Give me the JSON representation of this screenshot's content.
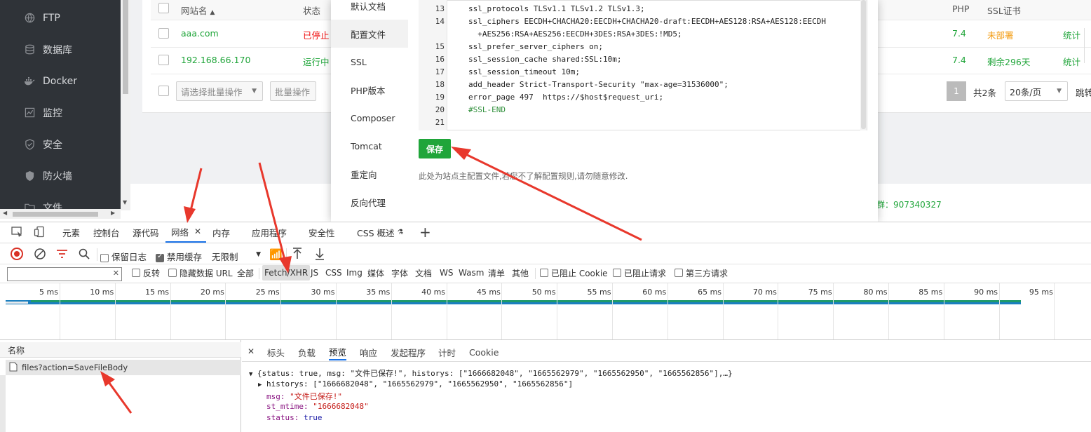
{
  "sidebar": {
    "items": [
      {
        "label": "FTP",
        "icon": "globe-icon"
      },
      {
        "label": "数据库",
        "icon": "database-icon"
      },
      {
        "label": "Docker",
        "icon": "docker-icon"
      },
      {
        "label": "监控",
        "icon": "monitor-icon"
      },
      {
        "label": "安全",
        "icon": "shield-icon"
      },
      {
        "label": "防火墙",
        "icon": "firewall-icon"
      },
      {
        "label": "文件",
        "icon": "folder-icon"
      }
    ]
  },
  "site_table": {
    "headers": {
      "name": "网站名",
      "status": "状态",
      "php": "PHP",
      "ssl": "SSL证书"
    },
    "rows": [
      {
        "name": "aaa.com",
        "status": "已停止",
        "php": "7.4",
        "ssl": "未部署",
        "action": "统计"
      },
      {
        "name": "192.168.66.170",
        "status": "运行中",
        "php": "7.4",
        "ssl": "剩余296天",
        "action": "统计"
      }
    ],
    "batch_select_placeholder": "请选择批量操作",
    "batch_button": "批量操作",
    "pagination": {
      "current_page": "1",
      "total": "共2条",
      "per_page": "20条/页",
      "jump": "跳转"
    },
    "footer_text": "群：907340327"
  },
  "dialog": {
    "menu": [
      {
        "label": "默认文档",
        "active": false
      },
      {
        "label": "配置文件",
        "active": true
      },
      {
        "label": "SSL",
        "active": false
      },
      {
        "label": "PHP版本",
        "active": false
      },
      {
        "label": "Composer",
        "active": false
      },
      {
        "label": "Tomcat",
        "active": false
      },
      {
        "label": "重定向",
        "active": false
      },
      {
        "label": "反向代理",
        "active": false
      }
    ],
    "editor_lines": [
      {
        "num": "13",
        "text": "ssl_protocols TLSv1.1 TLSv1.2 TLSv1.3;"
      },
      {
        "num": "14",
        "text": "ssl_ciphers EECDH+CHACHA20:EECDH+CHACHA20-draft:EECDH+AES128:RSA+AES128:EECDH"
      },
      {
        "num": "",
        "text": "  +AES256:RSA+AES256:EECDH+3DES:RSA+3DES:!MD5;"
      },
      {
        "num": "15",
        "text": "ssl_prefer_server_ciphers on;"
      },
      {
        "num": "16",
        "text": "ssl_session_cache shared:SSL:10m;"
      },
      {
        "num": "17",
        "text": "ssl_session_timeout 10m;"
      },
      {
        "num": "18",
        "text": "add_header Strict-Transport-Security \"max-age=31536000\";"
      },
      {
        "num": "19",
        "text": "error_page 497  https://$host$request_uri;"
      },
      {
        "num": "20",
        "text": "#SSL-END"
      },
      {
        "num": "21",
        "text": ""
      }
    ],
    "save_label": "保存",
    "note": "此处为站点主配置文件,若您不了解配置规则,请勿随意修改."
  },
  "devtools": {
    "tabs": [
      "元素",
      "控制台",
      "源代码",
      "网络",
      "内存",
      "应用程序",
      "安全性",
      "CSS 概述"
    ],
    "active_tab": "网络",
    "toolbar": {
      "preserve_log": "保留日志",
      "disable_cache": "禁用缓存",
      "throttle": "无限制"
    },
    "filters": {
      "invert": "反转",
      "hide_data_url": "隐藏数据 URL",
      "types": [
        "全部",
        "Fetch/XHR",
        "JS",
        "CSS",
        "Img",
        "媒体",
        "字体",
        "文档",
        "WS",
        "Wasm",
        "清单",
        "其他"
      ],
      "active_type": "Fetch/XHR",
      "blocked_cookie": "已阻止 Cookie",
      "blocked_requests": "已阻止请求",
      "third_party": "第三方请求"
    },
    "timeline_ticks": [
      "5 ms",
      "10 ms",
      "15 ms",
      "20 ms",
      "25 ms",
      "30 ms",
      "35 ms",
      "40 ms",
      "45 ms",
      "50 ms",
      "55 ms",
      "60 ms",
      "65 ms",
      "70 ms",
      "75 ms",
      "80 ms",
      "85 ms",
      "90 ms",
      "95 ms",
      "10"
    ],
    "request_list": {
      "header": "名称",
      "requests": [
        "files?action=SaveFileBody"
      ]
    },
    "detail_tabs": [
      "标头",
      "负载",
      "预览",
      "响应",
      "发起程序",
      "计时",
      "Cookie"
    ],
    "active_detail_tab": "预览",
    "preview": {
      "summary": "{status: true, msg: \"文件已保存!\", historys: [\"1666682048\", \"1665562979\", \"1665562950\", \"1665562856\"],…}",
      "historys": "historys: [\"1666682048\", \"1665562979\", \"1665562950\", \"1665562856\"]",
      "msg_key": "msg:",
      "msg_val": "\"文件已保存!\"",
      "mtime_key": "st_mtime:",
      "mtime_val": "\"1666682048\"",
      "status_key": "status:",
      "status_val": "true"
    }
  },
  "colors": {
    "accent_green": "#20a53a",
    "sidebar_bg": "#2f3338",
    "annotation_red": "#e8382c",
    "devtools_blue": "#1a73e8"
  }
}
